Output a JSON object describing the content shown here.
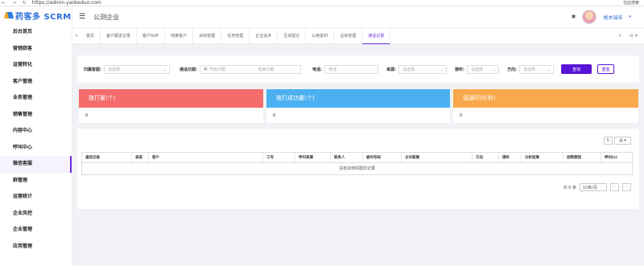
{
  "browser": {
    "url": "https://admin.yaokeduo.com",
    "nav": "← → ↻",
    "search_label": "在此搜索"
  },
  "logo": {
    "text": "药客多 SCRM"
  },
  "sidebar": {
    "items": [
      {
        "label": "后台首页"
      },
      {
        "label": "营销获客"
      },
      {
        "label": "运营转化"
      },
      {
        "label": "客户管理"
      },
      {
        "label": "业务管理"
      },
      {
        "label": "销售管理"
      },
      {
        "label": "内容中心"
      },
      {
        "label": "呼叫中心"
      },
      {
        "label": "微信客服"
      },
      {
        "label": "群管理"
      },
      {
        "label": "运营统计"
      },
      {
        "label": "企业风控"
      },
      {
        "label": "企业管理"
      },
      {
        "label": "应用管理"
      }
    ]
  },
  "header": {
    "menu_icon": "hamburger-icon",
    "company": "公测企业",
    "user_name": "姚木瑞采",
    "user_caret": "▾"
  },
  "tabs": {
    "left_arrow": "«",
    "items": [
      {
        "label": "首页"
      },
      {
        "label": "客户跟进记录"
      },
      {
        "label": "客户SOP"
      },
      {
        "label": "线索客户"
      },
      {
        "label": "目标管理"
      },
      {
        "label": "任务管理"
      },
      {
        "label": "企业话术"
      },
      {
        "label": "互动雷达"
      },
      {
        "label": "公用素材"
      },
      {
        "label": "业库管理"
      },
      {
        "label": "通话记录"
      }
    ],
    "right_arrow": "»",
    "more": "⊖ ▾"
  },
  "filters": {
    "external_contact": {
      "label": "归属客服:",
      "placeholder": "请选择"
    },
    "call_date": {
      "label": "通话日期:",
      "start_placeholder": "开始日期",
      "separator": "-",
      "end_placeholder": "结束日期"
    },
    "phone": {
      "label": "电话:",
      "placeholder": "电话"
    },
    "source": {
      "label": "来源:",
      "placeholder": "请选择"
    },
    "connected": {
      "label": "接听:",
      "placeholder": "请选择"
    },
    "direction": {
      "label": "方向:",
      "placeholder": "请选择"
    },
    "search_button": "查询",
    "reset_button": "重置"
  },
  "stats": [
    {
      "title": "拨打量(个)",
      "value": "0",
      "color": "#f56c6c"
    },
    {
      "title": "拨打成功量(个)",
      "value": "0",
      "color": "#4cb0f0"
    },
    {
      "title": "接通时间(秒)",
      "value": "0",
      "color": "#f9a94b"
    }
  ],
  "table": {
    "toolbar": {
      "refresh_icon": "↻",
      "columns_icon": "▥ ▾"
    },
    "columns": [
      "通话记录",
      "录音",
      "客户",
      "工号",
      "呼叫来源",
      "联系人",
      "被叫号码",
      "主叫客服",
      "方向",
      "接听",
      "分析结果",
      "挂断原因",
      "呼叫(s)"
    ],
    "empty_text": "没有找到匹配的记录"
  },
  "pagination": {
    "total_text": "共 0 条",
    "page_size": "10条/页",
    "prev": "‹",
    "next": "›"
  }
}
